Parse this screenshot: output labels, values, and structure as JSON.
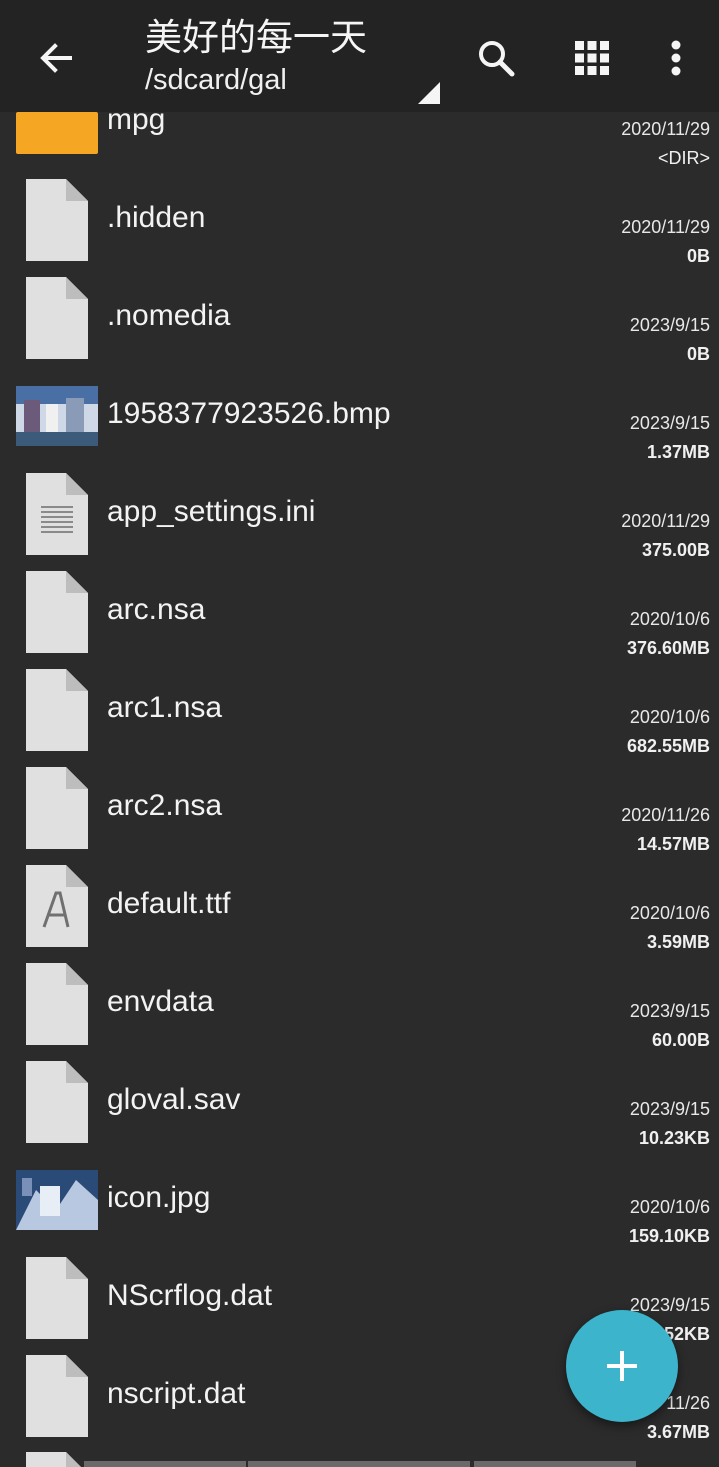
{
  "header": {
    "title": "美好的每一天",
    "path": "/sdcard/gal"
  },
  "icons": {
    "back": "arrow-left-icon",
    "search": "search-icon",
    "view": "grid-view-icon",
    "menu": "more-vert-icon",
    "fab": "plus-icon"
  },
  "colors": {
    "background": "#2b2b2b",
    "appbar": "#232323",
    "folder": "#f5a623",
    "file": "#e0e0e0",
    "fab": "#3cb4cc"
  },
  "files": [
    {
      "name": "mpg",
      "date": "2020/11/29",
      "size": "<DIR>",
      "type": "folder"
    },
    {
      "name": ".hidden",
      "date": "2020/11/29",
      "size": "0B",
      "type": "file"
    },
    {
      "name": ".nomedia",
      "date": "2023/9/15",
      "size": "0B",
      "type": "file"
    },
    {
      "name": "1958377923526.bmp",
      "date": "2023/9/15",
      "size": "1.37MB",
      "type": "image"
    },
    {
      "name": "app_settings.ini",
      "date": "2020/11/29",
      "size": "375.00B",
      "type": "text"
    },
    {
      "name": "arc.nsa",
      "date": "2020/10/6",
      "size": "376.60MB",
      "type": "file"
    },
    {
      "name": "arc1.nsa",
      "date": "2020/10/6",
      "size": "682.55MB",
      "type": "file"
    },
    {
      "name": "arc2.nsa",
      "date": "2020/11/26",
      "size": "14.57MB",
      "type": "file"
    },
    {
      "name": "default.ttf",
      "date": "2020/10/6",
      "size": "3.59MB",
      "type": "font"
    },
    {
      "name": "envdata",
      "date": "2023/9/15",
      "size": "60.00B",
      "type": "file"
    },
    {
      "name": "gloval.sav",
      "date": "2023/9/15",
      "size": "10.23KB",
      "type": "file"
    },
    {
      "name": "icon.jpg",
      "date": "2020/10/6",
      "size": "159.10KB",
      "type": "image"
    },
    {
      "name": "NScrflog.dat",
      "date": "2023/9/15",
      "size": "52KB",
      "type": "file"
    },
    {
      "name": "nscript.dat",
      "date": "11/26",
      "size": "3.67MB",
      "type": "file"
    }
  ]
}
